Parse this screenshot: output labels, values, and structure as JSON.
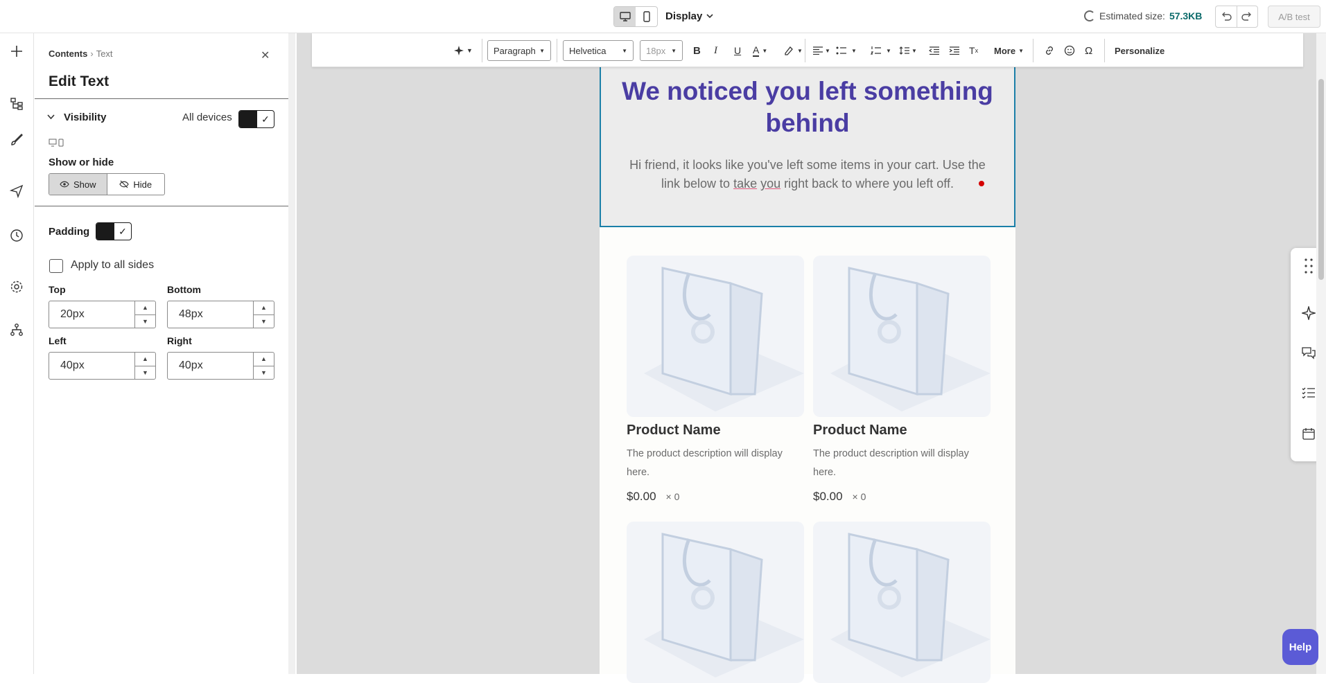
{
  "topbar": {
    "display_label": "Display",
    "estimated_label": "Estimated size:",
    "estimated_value": "57.3KB",
    "ab_test_label": "A/B test"
  },
  "panel": {
    "breadcrumb_root": "Contents",
    "breadcrumb_current": "Text",
    "title": "Edit Text",
    "visibility_label": "Visibility",
    "all_devices_label": "All devices",
    "show_or_hide_label": "Show or hide",
    "show_label": "Show",
    "hide_label": "Hide",
    "padding_label": "Padding",
    "apply_all_label": "Apply to all sides",
    "top_label": "Top",
    "top_value": "20px",
    "bottom_label": "Bottom",
    "bottom_value": "48px",
    "left_label": "Left",
    "left_value": "40px",
    "right_label": "Right",
    "right_value": "40px"
  },
  "toolbar": {
    "block_type": "Paragraph",
    "font_family": "Helvetica",
    "font_size": "18px",
    "more_label": "More",
    "personalize_label": "Personalize"
  },
  "email": {
    "hero_title": "We noticed you left something behind",
    "hero_body_pre": "Hi friend, it looks like you've left some items in your cart. Use the link below to ",
    "hero_body_u1": "take",
    "hero_body_mid": " ",
    "hero_body_u2": "you",
    "hero_body_post": " right back to where you left off.",
    "products": [
      {
        "name": "Product Name",
        "description": "The product description will display here.",
        "price": "$0.00",
        "qty": "× 0"
      },
      {
        "name": "Product Name",
        "description": "The product description will display here.",
        "price": "$0.00",
        "qty": "× 0"
      },
      {
        "name": "",
        "description": "",
        "price": "",
        "qty": ""
      },
      {
        "name": "",
        "description": "",
        "price": "",
        "qty": ""
      }
    ]
  },
  "help_label": "Help",
  "colors": {
    "accent": "#4a3da3",
    "selection_border": "#1a7fa8",
    "help_button": "#5b5bd6"
  }
}
